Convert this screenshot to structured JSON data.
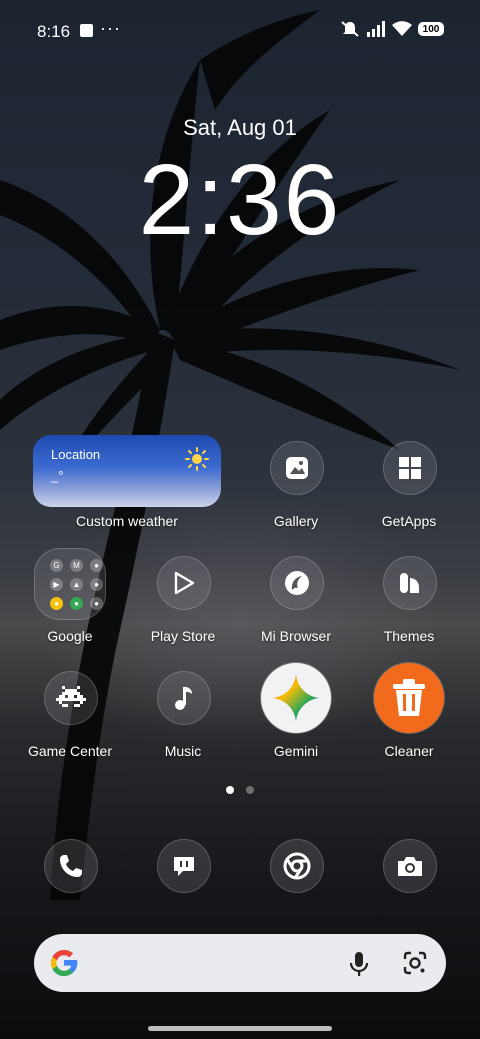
{
  "status_bar": {
    "time": "8:16",
    "overflow": "···",
    "battery": "100"
  },
  "lock_clock": {
    "date": "Sat, Aug 01",
    "time": "2:36"
  },
  "weather_widget": {
    "location": "Location",
    "temp": "_°",
    "label": "Custom weather"
  },
  "apps": {
    "gallery": "Gallery",
    "getapps": "GetApps",
    "google": "Google",
    "play_store": "Play Store",
    "mi_browser": "Mi Browser",
    "themes": "Themes",
    "game_center": "Game Center",
    "music": "Music",
    "gemini": "Gemini",
    "cleaner": "Cleaner"
  },
  "google_folder_icons": [
    "G",
    "M",
    "●",
    "▶",
    "▲",
    "●",
    "●",
    "●",
    "●"
  ],
  "dock": [
    "phone-icon",
    "messages-icon",
    "chrome-icon",
    "camera-icon"
  ],
  "colors": {
    "weather_top": "#1e4bb2",
    "cleaner_orange": "#f26a1b",
    "search_bg": "#e9ebee"
  }
}
